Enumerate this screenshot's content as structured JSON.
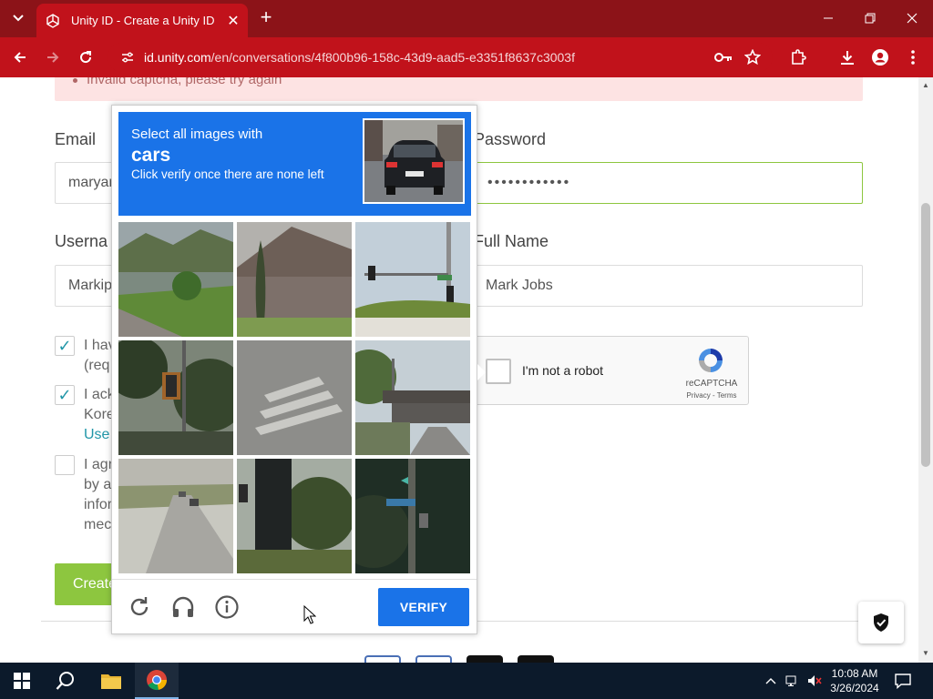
{
  "browser": {
    "tab_title": "Unity ID - Create a Unity ID",
    "url_host": "id.unity.com",
    "url_path": "/en/conversations/4f800b96-158c-43d9-aad5-e3351f8637c3003f",
    "accent_color": "#c1121b",
    "tabbar_color": "#8c1318"
  },
  "form": {
    "error_text": "Invalid captcha, please try again",
    "email_label": "Email",
    "email_value": "maryar",
    "password_label": "Password",
    "password_value": "••••••••••••",
    "username_label": "Userna",
    "username_value": "Markip",
    "fullname_label": "Full Name",
    "fullname_value": "Mark Jobs",
    "checkbox1": {
      "checked": true,
      "line1": "I hav",
      "line2": "(req"
    },
    "checkbox2": {
      "checked": true,
      "line1": "I ack",
      "line2": "Kore",
      "link": "Use"
    },
    "checkbox3": {
      "checked": false,
      "line1": "I agr",
      "line2": "by a",
      "line3": "infor",
      "line4": "mec"
    },
    "create_button": "Create",
    "accent_green": "#8dc63f",
    "link_color": "#2196a8"
  },
  "recaptcha": {
    "not_robot_label": "I'm not a robot",
    "brand": "reCAPTCHA",
    "privacy": "Privacy",
    "terms": "Terms",
    "separator": " - "
  },
  "challenge": {
    "instruction_line1": "Select all images with",
    "target": "cars",
    "instruction_line3": "Click verify once there are none left",
    "verify_label": "VERIFY",
    "header_color": "#1a73e8",
    "tiles": [
      "river-and-hills",
      "house-with-cypress-trees",
      "traffic-light-on-pole",
      "traffic-light-and-trees",
      "crosswalk-road",
      "bridge-over-road",
      "road-with-cars",
      "tree-and-pole",
      "street-sign-pole"
    ],
    "footer_icons": [
      "reload-icon",
      "headphones-icon",
      "info-icon"
    ]
  },
  "taskbar": {
    "time": "10:08 AM",
    "date": "3/26/2024",
    "apps": [
      "start-icon",
      "search-icon",
      "file-explorer-icon",
      "chrome-icon"
    ]
  }
}
